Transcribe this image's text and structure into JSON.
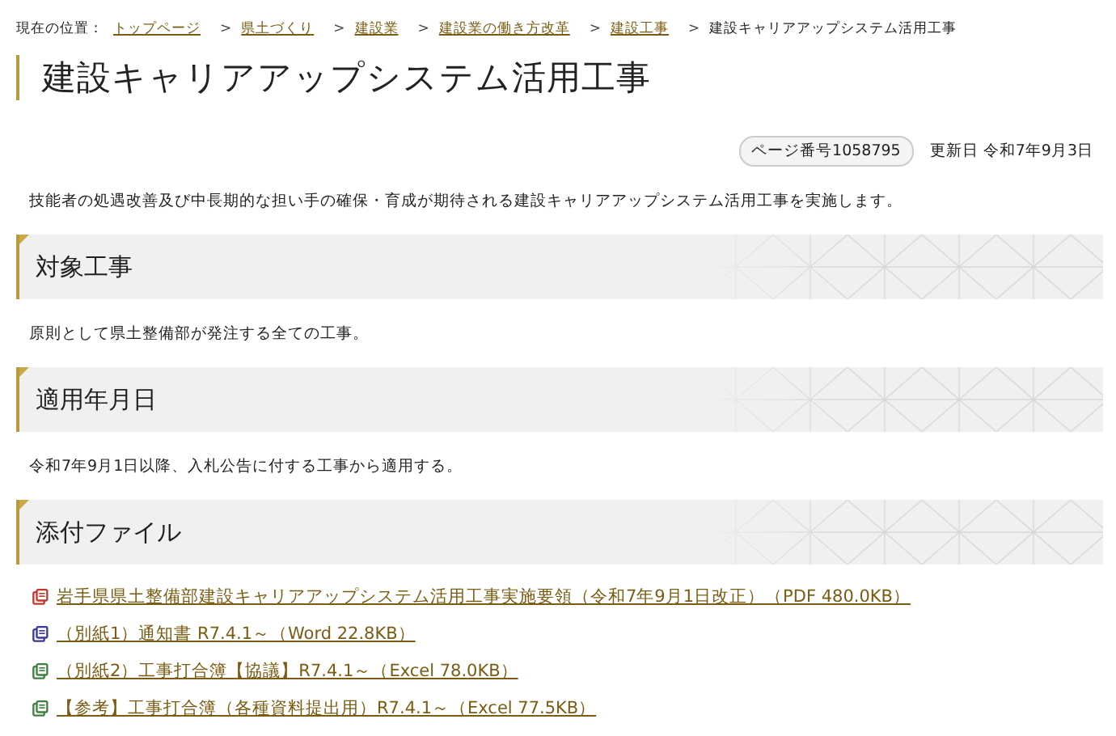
{
  "breadcrumb": {
    "label": "現在の位置：",
    "items": [
      {
        "kind": "link",
        "text": "トップページ"
      },
      {
        "kind": "separator",
        "text": ">"
      },
      {
        "kind": "link",
        "text": "県土づくり"
      },
      {
        "kind": "separator",
        "text": ">"
      },
      {
        "kind": "link",
        "text": "建設業"
      },
      {
        "kind": "separator",
        "text": ">"
      },
      {
        "kind": "link",
        "text": "建設業の働き方改革"
      },
      {
        "kind": "separator",
        "text": ">"
      },
      {
        "kind": "link",
        "text": "建設工事"
      },
      {
        "kind": "separator",
        "text": ">"
      },
      {
        "kind": "current",
        "text": "建設キャリアアップシステム活用工事"
      }
    ]
  },
  "title": "建設キャリアアップシステム活用工事",
  "page_number": "ページ番号1058795",
  "updated": "更新日 令和7年9月3日",
  "intro": "技能者の処遇改善及び中長期的な担い手の確保・育成が期待される建設キャリアアップシステム活用工事を実施します。",
  "sections": [
    {
      "heading": "対象工事",
      "text": "原則として県土整備部が発注する全ての工事。"
    },
    {
      "heading": "適用年月日",
      "text": "令和7年9月1日以降、入札公告に付する工事から適用する。"
    },
    {
      "heading": "添付ファイル",
      "files": [
        {
          "kind": "pdf",
          "label": "岩手県県土整備部建設キャリアアップシステム活用工事実施要領（令和7年9月1日改正）（PDF 480.0KB）"
        },
        {
          "kind": "word",
          "label": "（別紙1）通知書 R7.4.1～（Word 22.8KB）"
        },
        {
          "kind": "excel",
          "label": "（別紙2）工事打合簿【協議】R7.4.1～（Excel 78.0KB）"
        },
        {
          "kind": "excel",
          "label": "【参考】工事打合簿（各種資料提出用）R7.4.1～（Excel 77.5KB）"
        }
      ]
    }
  ]
}
